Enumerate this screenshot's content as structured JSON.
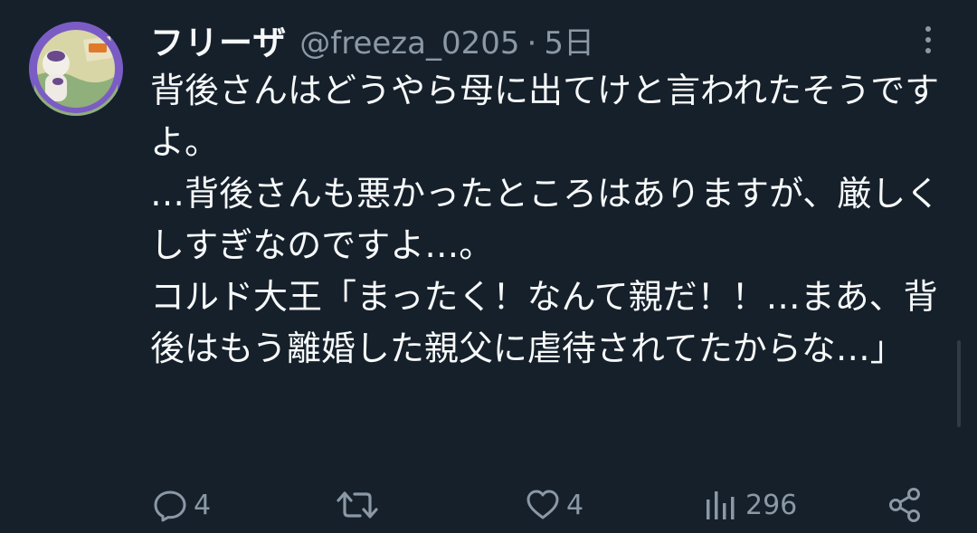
{
  "tweet": {
    "author": {
      "display_name": "フリーザ",
      "handle": "@freeza_0205",
      "separator": "·",
      "time": "5日"
    },
    "body": {
      "line1": "背後さんはどうやら母に出てけと言われたそうですよ。",
      "line2": "…背後さんも悪かったところはありますが、厳しくしすぎなのですよ…。",
      "line3": "",
      "line4": "コルド大王「まったく！なんて親だ！！…まあ、背後はもう離婚した親父に虐待されてたからな…」"
    },
    "actions": {
      "reply_count": "4",
      "retweet_count": "",
      "like_count": "4",
      "views_count": "296"
    },
    "icons": {
      "more": "more-vertical-icon",
      "reply": "reply-icon",
      "retweet": "retweet-icon",
      "like": "heart-icon",
      "views": "views-icon",
      "share": "share-icon"
    },
    "colors": {
      "background": "#15202b",
      "text_primary": "#f7f9f9",
      "text_secondary": "#8b98a5",
      "avatar_ring": "#7b5cc4"
    }
  }
}
